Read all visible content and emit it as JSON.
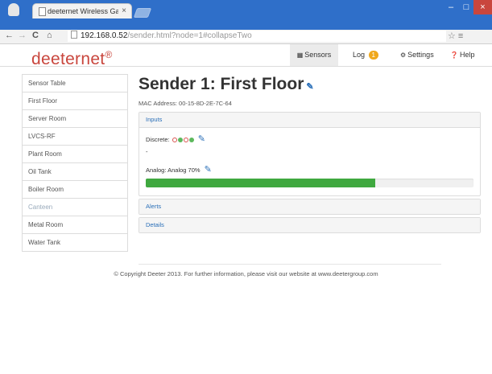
{
  "browser": {
    "tab_title": "deeternet Wireless Gatew...",
    "tab_close": "×",
    "address_host": "192.168.0.52",
    "address_path": "/sender.html?node=1#collapseTwo",
    "nav_back": "←",
    "nav_forward": "→",
    "nav_reload": "C",
    "nav_home": "⌂",
    "win_min": "–",
    "win_max": "□",
    "win_close": "×",
    "toolbar_icons": "☆ ≡"
  },
  "navbar": {
    "brand": "deeternet",
    "brand_reg": "®",
    "links": {
      "sensors": "Sensors",
      "log": "Log",
      "log_badge": "1",
      "settings": "Settings",
      "help": "Help"
    },
    "icons": [
      "table-icon",
      "gear-icon",
      "question-icon"
    ]
  },
  "sidebar": {
    "items": [
      {
        "label": "Sensor Table"
      },
      {
        "label": "First Floor"
      },
      {
        "label": "Server Room"
      },
      {
        "label": "LVCS-RF"
      },
      {
        "label": "Plant Room"
      },
      {
        "label": "Oil Tank"
      },
      {
        "label": "Boiler Room"
      },
      {
        "label": "Canteen"
      },
      {
        "label": "Metal Room"
      },
      {
        "label": "Water Tank"
      }
    ]
  },
  "main": {
    "title": "Sender 1: First Floor",
    "mac": "MAC Address: 00-15-8D-2E-7C-64",
    "inputs": {
      "heading": "Inputs",
      "discrete_label": "Discrete:",
      "discrete_states": [
        "off",
        "on",
        "off",
        "on"
      ],
      "dash": "-",
      "analog_label": "Analog: Analog 70%",
      "analog_value": 0.7
    },
    "alerts": "Alerts",
    "details": "Details"
  },
  "colors": {
    "brand": "#c9463d",
    "link": "#2a6fb8",
    "progress": "#3fa83f",
    "badge": "#f0a81c"
  },
  "footer": "© Copyright Deeter 2013. For further information, please visit our website at www.deetergroup.com"
}
